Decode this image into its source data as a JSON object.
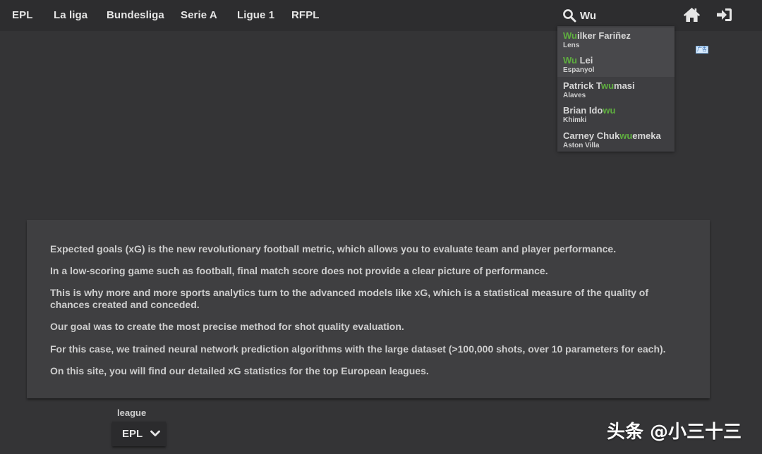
{
  "nav": {
    "items": [
      {
        "label": "EPL"
      },
      {
        "label": "La liga"
      },
      {
        "label": "Bundesliga"
      },
      {
        "label": "Serie A"
      },
      {
        "label": "Ligue 1"
      },
      {
        "label": "RFPL"
      }
    ]
  },
  "search": {
    "value": "Wu",
    "icon": "search-icon"
  },
  "header_icons": [
    "home-icon",
    "login-icon"
  ],
  "suggestions": [
    {
      "pre": "",
      "match": "Wu",
      "post": "ilker Fariñez",
      "team": "Lens"
    },
    {
      "pre": "",
      "match": "Wu",
      "post": " Lei",
      "team": "Espanyol"
    },
    {
      "pre": "Patrick T",
      "match": "wu",
      "post": "masi",
      "team": "Alaves"
    },
    {
      "pre": "Brian Ido",
      "match": "wu",
      "post": "",
      "team": "Khimki"
    },
    {
      "pre": "Carney Chuk",
      "match": "wu",
      "post": "emeka",
      "team": "Aston Villa"
    }
  ],
  "ad_label": "广告",
  "panel": {
    "paragraphs": [
      "Expected goals (xG) is the new revolutionary football metric, which allows you to evaluate team and player performance.",
      "In a low-scoring game such as football, final match score does not provide a clear picture of performance.",
      "This is why more and more sports analytics turn to the advanced models like xG, which is a statistical measure of the quality of chances created and conceded.",
      "Our goal was to create the most precise method for shot quality evaluation.",
      "For this case, we trained neural network prediction algorithms with the large dataset (>100,000 shots, over 10 parameters for each).",
      "On this site, you will find our detailed xG statistics for the top European leagues."
    ]
  },
  "league_select": {
    "label": "league",
    "value": "EPL"
  },
  "watermark": "头条 @小三十三",
  "colors": {
    "background": "#343436",
    "topbar": "#2d2d2f",
    "match_highlight": "#5fae3f",
    "panel": "#3f3f41"
  }
}
